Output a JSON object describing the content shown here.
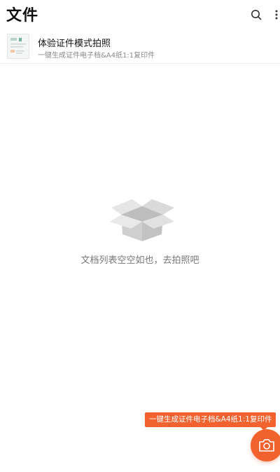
{
  "header": {
    "title": "文件",
    "search_icon": "search-icon",
    "more_icon": "more-vertical-icon"
  },
  "promo": {
    "title": "体验证件模式拍照",
    "subtitle": "一键生成证件电子档&A4纸1:1复印件",
    "thumb_icon": "id-document-icon"
  },
  "empty_state": {
    "icon": "empty-box-icon",
    "message": "文档列表空空如也，去拍照吧"
  },
  "camera": {
    "hint": "一键生成证件电子档&A4纸1:1复印件",
    "icon": "camera-icon",
    "accent_color": "#f2622f"
  }
}
